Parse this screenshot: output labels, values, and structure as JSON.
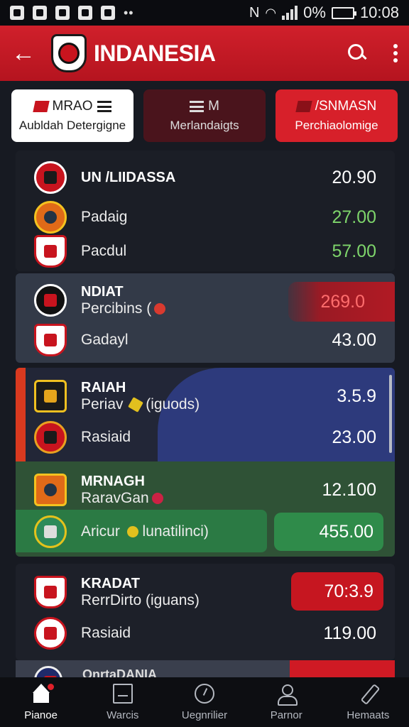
{
  "status_bar": {
    "battery": "0%",
    "time": "10:08"
  },
  "app_bar": {
    "title": "INDANESIA"
  },
  "tabs": [
    {
      "label_top": "MRAO",
      "label_bottom": "Aubldah Detergigne"
    },
    {
      "label_top": "M",
      "label_bottom": "Merlandaigts"
    },
    {
      "label_top": "/SNMASN",
      "label_bottom": "Perchiaolomige"
    }
  ],
  "groups": [
    {
      "title": "UN /LIIDASSA",
      "rows": [
        {
          "name": "UN /LIIDASSA",
          "odds": "20.90"
        },
        {
          "name": "Padaig",
          "odds": "27.00"
        },
        {
          "name": "Pacdul",
          "odds": "57.00"
        }
      ]
    },
    {
      "title": "NDIAT",
      "rows": [
        {
          "name": "Percibins (",
          "odds": "269.0"
        },
        {
          "name": "Gadayl",
          "odds": "43.00"
        }
      ]
    },
    {
      "title": "RAIAH",
      "rows": [
        {
          "name": "Periav",
          "suffix": "(iguods)",
          "odds": "3.5.9"
        },
        {
          "name": "Rasiaid",
          "odds": "23.00"
        }
      ]
    },
    {
      "title": "MRNAGH",
      "rows": [
        {
          "name": "RaravGan",
          "odds": "12.100"
        },
        {
          "name": "Aricur",
          "suffix": "lunatilinci)",
          "odds": "455.00"
        }
      ]
    },
    {
      "title": "KRADAT",
      "rows": [
        {
          "name": "RerrDirto (iguans)",
          "odds": "70:3.9"
        },
        {
          "name": "Rasiaid",
          "odds": "119.00"
        }
      ]
    }
  ],
  "partial_row": {
    "text": "OnrtaDANIA"
  },
  "bottom_nav": [
    {
      "label": "Pianoe",
      "icon": "home-icon"
    },
    {
      "label": "Warcis",
      "icon": "box-icon"
    },
    {
      "label": "Uegnrilier",
      "icon": "gauge-icon"
    },
    {
      "label": "Parnor",
      "icon": "user-icon"
    },
    {
      "label": "Hemaats",
      "icon": "pen-icon"
    }
  ],
  "colors": {
    "brand_red": "#d0202b",
    "green": "#2f8b4a",
    "navy": "#2d3a7c"
  }
}
